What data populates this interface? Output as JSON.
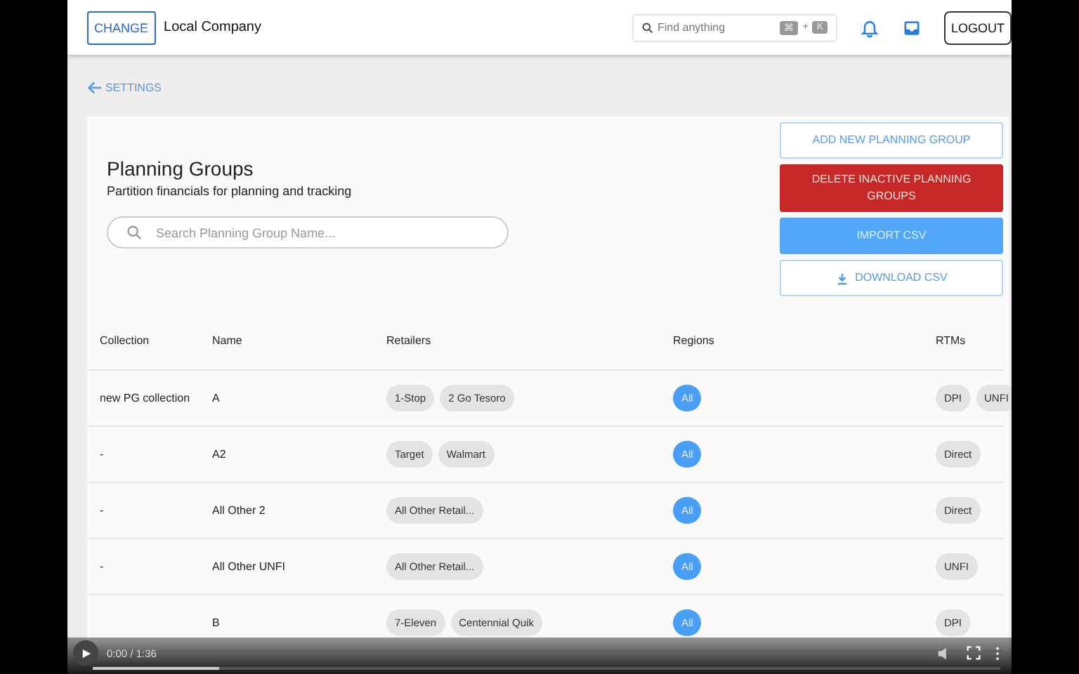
{
  "header": {
    "change_button": "CHANGE",
    "company": "Local Company",
    "search": {
      "placeholder": "Find anything",
      "keys": [
        "⌘",
        "K"
      ],
      "joiner": "+"
    },
    "logout": "LOGOUT"
  },
  "back_link": "SETTINGS",
  "page": {
    "title": "Planning Groups",
    "subtitle": "Partition financials for planning and tracking",
    "search_placeholder": "Search Planning Group Name...",
    "buttons": [
      {
        "label": "ADD NEW PLANNING GROUP",
        "kind": "outline"
      },
      {
        "label": "DELETE INACTIVE PLANNING GROUPS",
        "kind": "danger"
      },
      {
        "label": "IMPORT CSV",
        "kind": "primary"
      },
      {
        "label": "DOWNLOAD CSV",
        "kind": "download"
      }
    ]
  },
  "table": {
    "columns": [
      "Collection",
      "Name",
      "Retailers",
      "Regions",
      "RTMs"
    ],
    "rows": [
      {
        "collection": "new PG collection",
        "name": "A",
        "retailers": [
          "1-Stop",
          "2 Go Tesoro"
        ],
        "regions": [
          "All"
        ],
        "rtms": [
          "DPI",
          "UNFI"
        ]
      },
      {
        "collection": "-",
        "name": "A2",
        "retailers": [
          "Target",
          "Walmart"
        ],
        "regions": [
          "All"
        ],
        "rtms": [
          "Direct"
        ]
      },
      {
        "collection": "-",
        "name": "All Other 2",
        "retailers": [
          "All Other Retail..."
        ],
        "regions": [
          "All"
        ],
        "rtms": [
          "Direct"
        ]
      },
      {
        "collection": "-",
        "name": "All Other UNFI",
        "retailers": [
          "All Other Retail..."
        ],
        "regions": [
          "All"
        ],
        "rtms": [
          "UNFI"
        ]
      },
      {
        "collection": "",
        "name": "B",
        "retailers": [
          "7-Eleven",
          "Centennial Quik"
        ],
        "regions": [
          "All"
        ],
        "rtms": [
          "DPI"
        ]
      }
    ]
  },
  "video": {
    "time": "0:00 / 1:36",
    "level": 0.14
  }
}
